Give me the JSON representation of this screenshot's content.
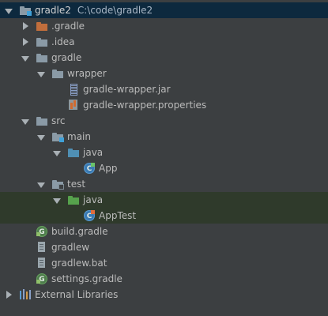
{
  "tree": {
    "project": {
      "name": "gradle2",
      "path": "C:\\code\\gradle2"
    },
    "items": [
      {
        "label": ".gradle",
        "arrow": "closed",
        "icon": "folder-icon-orange"
      },
      {
        "label": ".idea",
        "arrow": "closed",
        "icon": "folder-icon"
      },
      {
        "label": "gradle",
        "arrow": "open",
        "icon": "folder-icon"
      },
      {
        "label": "wrapper",
        "arrow": "open",
        "icon": "folder-icon"
      },
      {
        "label": "gradle-wrapper.jar",
        "icon": "jar-file-icon"
      },
      {
        "label": "gradle-wrapper.properties",
        "icon": "properties-file-icon"
      },
      {
        "label": "src",
        "arrow": "open",
        "icon": "folder-icon"
      },
      {
        "label": "main",
        "arrow": "open",
        "icon": "module-folder-icon"
      },
      {
        "label": "java",
        "arrow": "open",
        "icon": "source-root-folder-icon"
      },
      {
        "label": "App",
        "icon": "java-class-icon"
      },
      {
        "label": "test",
        "arrow": "open",
        "icon": "module-folder-icon"
      },
      {
        "label": "java",
        "arrow": "open",
        "icon": "test-root-folder-icon"
      },
      {
        "label": "AppTest",
        "icon": "java-class-icon"
      },
      {
        "label": "build.gradle",
        "icon": "gradle-file-icon"
      },
      {
        "label": "gradlew",
        "icon": "text-file-icon"
      },
      {
        "label": "gradlew.bat",
        "icon": "text-file-icon"
      },
      {
        "label": "settings.gradle",
        "icon": "gradle-file-icon"
      },
      {
        "label": "External Libraries",
        "arrow": "closed",
        "icon": "libraries-icon"
      }
    ]
  },
  "colors": {
    "background": "#3c3f41",
    "selection": "#0d293e",
    "test_highlight": "#2f3a2b",
    "text": "#bbbbbb",
    "folder": "#8a9aa6",
    "source_root": "#4f8fb4",
    "test_root": "#56a24c",
    "excluded": "#c26e3c"
  }
}
